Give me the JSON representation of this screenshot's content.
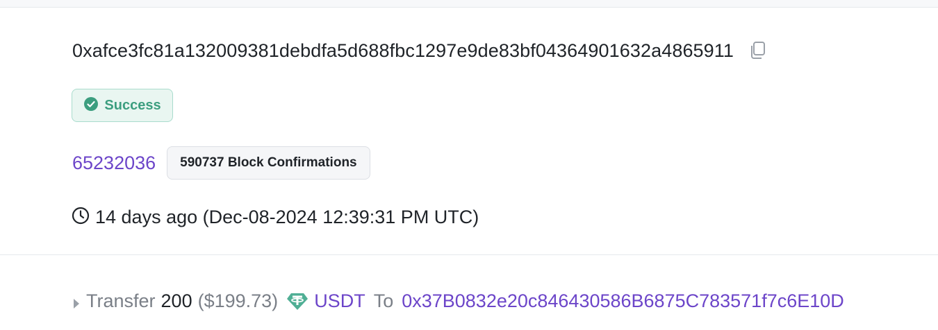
{
  "transaction": {
    "hash": "0xafce3fc81a132009381debdfa5d688fbc1297e9de83bf04364901632a4865911",
    "status": "Success",
    "block_number": "65232036",
    "confirmations": "590737 Block Confirmations",
    "timestamp": "14 days ago (Dec-08-2024 12:39:31 PM UTC)"
  },
  "transfer": {
    "action": "Transfer",
    "amount": "200",
    "usd_value": "($199.73)",
    "token": "USDT",
    "to_label": "To",
    "to_address": "0x37B0832e20c846430586B6875C783571f7c6E10D"
  },
  "colors": {
    "success": "#3c9e7f",
    "link": "#6c45c9",
    "token_brand": "#50af95"
  },
  "icons": [
    "copy-icon",
    "check-circle-icon",
    "clock-icon",
    "caret-right-icon",
    "tether-icon"
  ]
}
